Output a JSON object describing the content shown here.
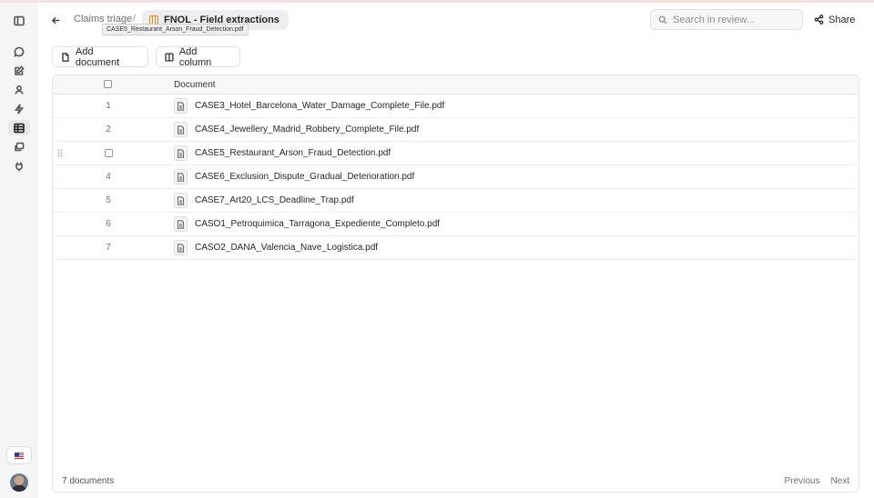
{
  "rail": {
    "items": [
      {
        "icon": "panel-toggle-icon",
        "active": false
      },
      {
        "icon": "chat-icon",
        "active": false
      },
      {
        "icon": "edit-document-icon",
        "active": false
      },
      {
        "icon": "user-icon",
        "active": false
      },
      {
        "icon": "bolt-icon",
        "active": false
      },
      {
        "icon": "table-icon",
        "active": true
      },
      {
        "icon": "copy-icon",
        "active": false
      },
      {
        "icon": "plug-icon",
        "active": false
      }
    ],
    "language_flag": "us-flag-icon"
  },
  "header": {
    "breadcrumb_parent": "Claims triage",
    "breadcrumb_separator": "/",
    "breadcrumb_current": "FNOL - Field extractions",
    "tooltip": "CASE5_Restaurant_Arson_Fraud_Detection.pdf",
    "search_placeholder": "Search in review...",
    "share_label": "Share"
  },
  "toolbar": {
    "add_document_label": "Add document",
    "add_column_label": "Add column"
  },
  "table": {
    "header_document": "Document",
    "rows": [
      {
        "num": "1",
        "name": "CASE3_Hotel_Barcelona_Water_Damage_Complete_File.pdf"
      },
      {
        "num": "2",
        "name": "CASE4_Jewellery_Madrid_Robbery_Complete_File.pdf"
      },
      {
        "num": "",
        "name": "CASE5_Restaurant_Arson_Fraud_Detection.pdf",
        "hover": true
      },
      {
        "num": "4",
        "name": "CASE6_Exclusion_Dispute_Gradual_Deterioration.pdf"
      },
      {
        "num": "5",
        "name": "CASE7_Art20_LCS_Deadline_Trap.pdf"
      },
      {
        "num": "6",
        "name": "CASO1_Petroquimica_Tarragona_Expediente_Completo.pdf"
      },
      {
        "num": "7",
        "name": "CASO2_DANA_Valencia_Nave_Logistica.pdf"
      }
    ]
  },
  "footer": {
    "count_label": "7 documents",
    "previous_label": "Previous",
    "next_label": "Next"
  }
}
